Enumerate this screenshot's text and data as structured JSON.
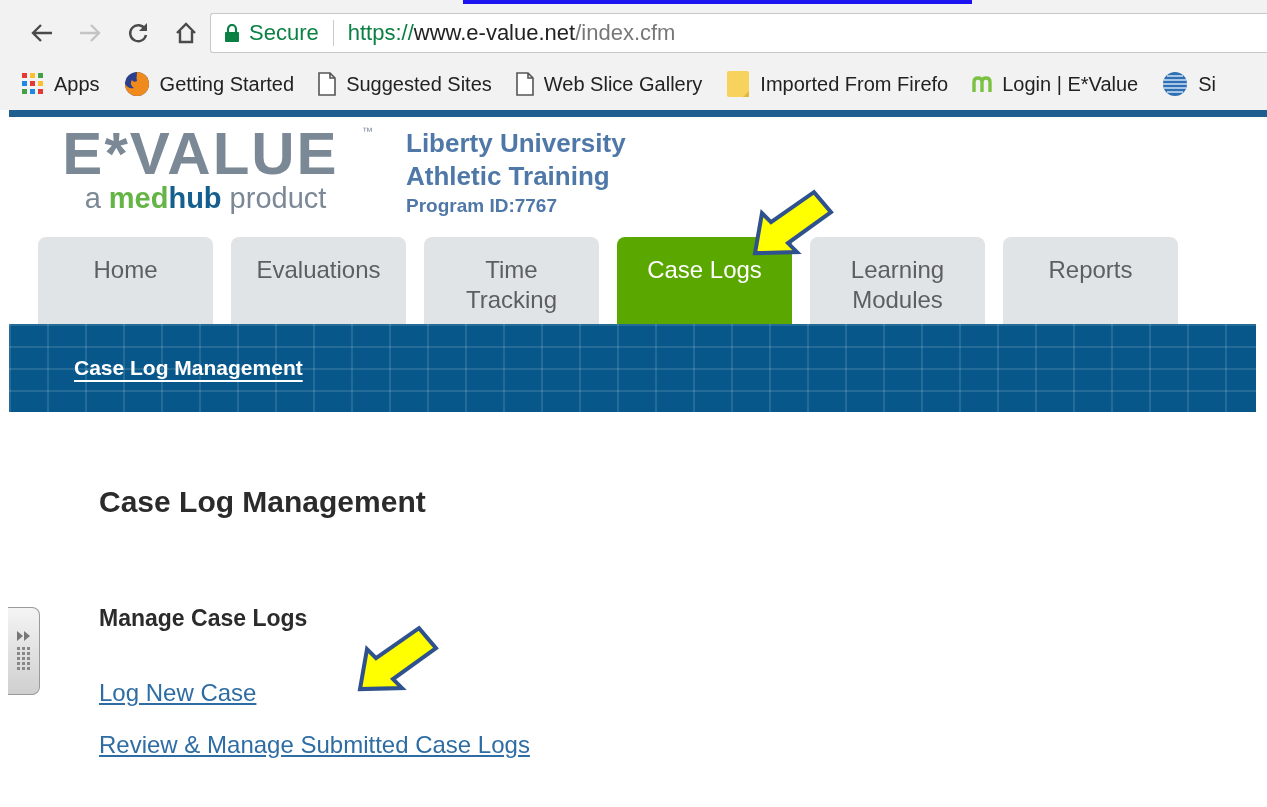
{
  "browser": {
    "nav_buttons": [
      {
        "kind": "back",
        "disabled": false
      },
      {
        "kind": "forward",
        "disabled": true
      },
      {
        "kind": "reload",
        "disabled": false
      },
      {
        "kind": "home",
        "disabled": false
      }
    ],
    "address": {
      "security": "Secure",
      "scheme": "https://",
      "host": "www.e-value.net",
      "path": "/index.cfm"
    },
    "bookmarks": [
      {
        "kind": "apps",
        "label": "Apps"
      },
      {
        "kind": "firefox",
        "label": "Getting Started"
      },
      {
        "kind": "page",
        "label": "Suggested Sites"
      },
      {
        "kind": "page",
        "label": "Web Slice Gallery"
      },
      {
        "kind": "folder",
        "label": "Imported From Firefo"
      },
      {
        "kind": "medhub",
        "label": "Login | E*Value"
      },
      {
        "kind": "globe",
        "label": "Si"
      }
    ]
  },
  "header": {
    "logo": {
      "wordmark": "E*VALUE",
      "trademark": "™",
      "tagline": [
        {
          "kind": "plain",
          "text": "a"
        },
        {
          "kind": "med",
          "text": "med"
        },
        {
          "kind": "hub",
          "text": "hub"
        },
        {
          "kind": "plain",
          "text": "product"
        }
      ]
    },
    "institution": "Liberty University",
    "program": "Athletic Training",
    "program_id": "Program ID:7767"
  },
  "tabs": [
    {
      "label": "Home",
      "selected": false
    },
    {
      "label": "Evaluations",
      "selected": false
    },
    {
      "label": "Time Tracking",
      "selected": false
    },
    {
      "label": "Case Logs",
      "selected": true
    },
    {
      "label": "Learning Modules",
      "selected": false
    },
    {
      "label": "Reports",
      "selected": false
    }
  ],
  "subnav": {
    "items": [
      {
        "label": "Case Log Management",
        "selected": true
      }
    ]
  },
  "content": {
    "title": "Case Log Management",
    "section": "Manage Case Logs",
    "links": [
      "Log New Case",
      "Review & Manage Submitted Case Logs"
    ]
  }
}
